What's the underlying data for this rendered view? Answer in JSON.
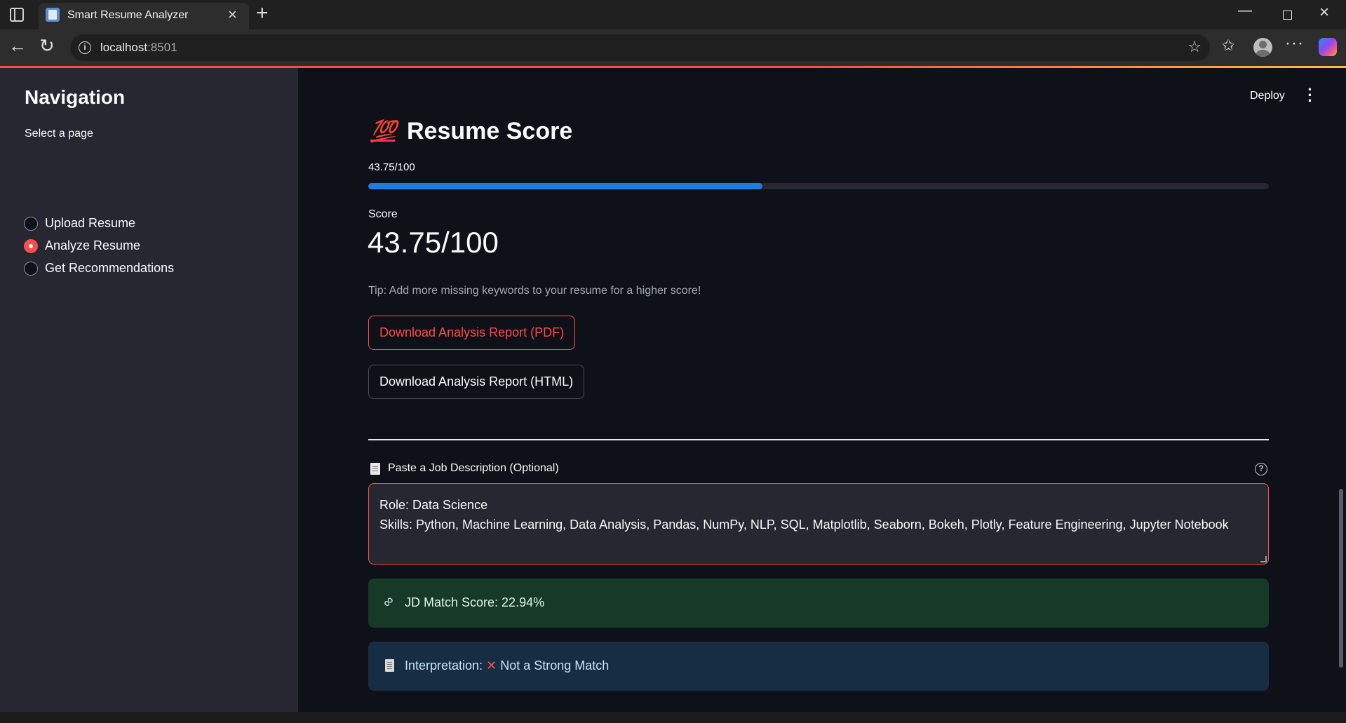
{
  "browser": {
    "tab_title": "Smart Resume Analyzer",
    "url_host": "localhost",
    "url_port": ":8501"
  },
  "sidebar": {
    "title": "Navigation",
    "radio_label": "Select a page",
    "items": [
      {
        "label": "Upload Resume",
        "selected": false
      },
      {
        "label": "Analyze Resume",
        "selected": true
      },
      {
        "label": "Get Recommendations",
        "selected": false
      }
    ]
  },
  "header": {
    "deploy_label": "Deploy"
  },
  "main": {
    "title_icon": "💯",
    "title": "Resume Score",
    "progress_text": "43.75/100",
    "progress_value": 0.4375,
    "metric_label": "Score",
    "metric_value": "43.75/100",
    "tip": "Tip: Add more missing keywords to your resume for a higher score!",
    "download_pdf_label": "Download Analysis Report (PDF)",
    "download_html_label": "Download Analysis Report (HTML)",
    "jd_label": "Paste a Job Description (Optional)",
    "jd_text": "Role: Data Science\nSkills: Python, Machine Learning, Data Analysis, Pandas, NumPy, NLP, SQL, Matplotlib, Seaborn, Bokeh, Plotly, Feature Engineering, Jupyter Notebook",
    "jd_match": "JD Match Score: 22.94%",
    "interpretation_prefix": "Interpretation:",
    "interpretation_value": "Not a Strong Match"
  },
  "colors": {
    "primary": "#ff4b4b",
    "progress": "#1f7ddb",
    "success_bg": "#173928",
    "info_bg": "#172d43",
    "sidebar_bg": "#262730",
    "main_bg": "#0e1117"
  }
}
